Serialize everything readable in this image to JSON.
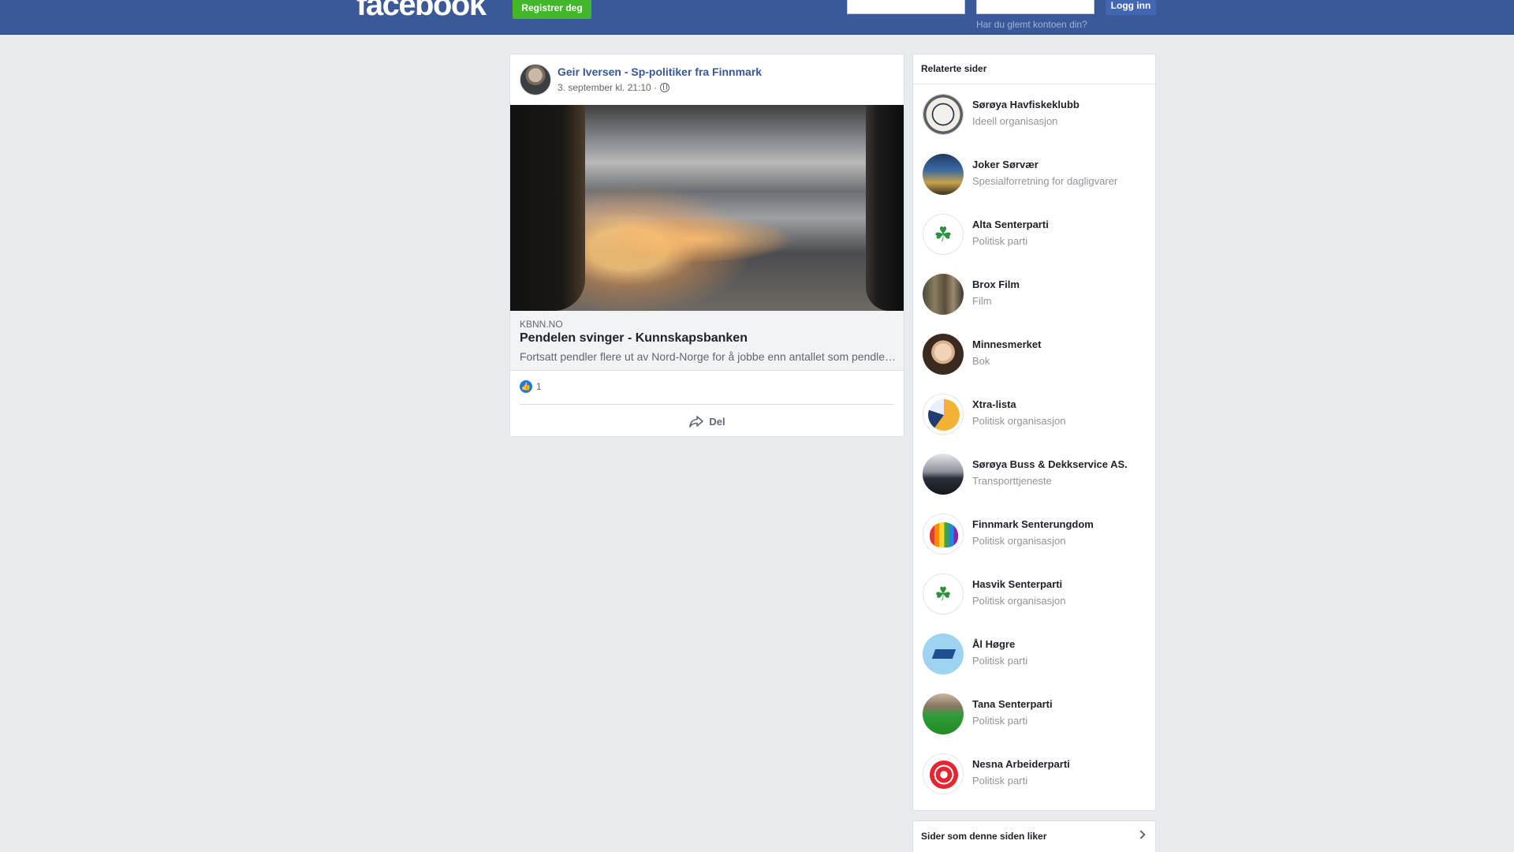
{
  "header": {
    "logo": "facebook",
    "register_label": "Registrer deg",
    "login_label": "Logg inn",
    "forgot_link": "Har du glemt kontoen din?",
    "email_value": "",
    "password_value": ""
  },
  "post": {
    "author": "Geir Iversen - Sp-politiker fra Finnmark",
    "timestamp": "3. september kl. 21:10 ·",
    "link": {
      "domain": "KBNN.NO",
      "title": "Pendelen svinger - Kunnskapsbanken",
      "description": "Fortsatt pendler flere ut av Nord-Norge for å jobbe enn antallet som pendler inn"
    },
    "like_count": "1",
    "share_label": "Del"
  },
  "related": {
    "title": "Relaterte sider",
    "items": [
      {
        "name": "Sørøya Havfiskeklubb",
        "category": "Ideell organisasjon"
      },
      {
        "name": "Joker Sørvær",
        "category": "Spesialforretning for dagligvarer"
      },
      {
        "name": "Alta Senterparti",
        "category": "Politisk parti"
      },
      {
        "name": "Brox Film",
        "category": "Film"
      },
      {
        "name": "Minnesmerket",
        "category": "Bok"
      },
      {
        "name": "Xtra-lista",
        "category": "Politisk organisasjon"
      },
      {
        "name": "Sørøya Buss & Dekkservice AS.",
        "category": "Transporttjeneste"
      },
      {
        "name": "Finnmark Senterungdom",
        "category": "Politisk organisasjon"
      },
      {
        "name": "Hasvik Senterparti",
        "category": "Politisk organisasjon"
      },
      {
        "name": "Ål Høgre",
        "category": "Politisk parti"
      },
      {
        "name": "Tana Senterparti",
        "category": "Politisk parti"
      },
      {
        "name": "Nesna Arbeiderparti",
        "category": "Politisk parti"
      }
    ]
  },
  "likes_section": {
    "title": "Sider som denne siden liker"
  },
  "colors": {
    "brand": "#3b5998",
    "register_green": "#42b72a",
    "link_blue": "#385898",
    "background": "#e9ebee"
  }
}
